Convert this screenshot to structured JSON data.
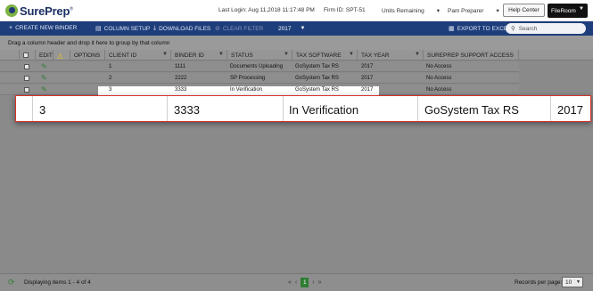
{
  "header": {
    "logo_text": "SurePrep",
    "logo_reg": "®",
    "last_login": "Last Login: Aug 11,2018 11:17:48 PM",
    "firm_id": "Firm ID:  SPT-51",
    "units_remaining": "Units Remaining",
    "user": "Pam Preparer",
    "help_label": "Help Center",
    "fileroom_label": "FileRoom"
  },
  "toolbar": {
    "create_label": "CREATE NEW BINDER",
    "column_setup_label": "COLUMN SETUP",
    "download_label": "DOWNLOAD FILES",
    "clear_filter_label": "CLEAR FILTER",
    "year": "2017",
    "export_label": "EXPORT TO EXCEL",
    "search_placeholder": "Search"
  },
  "grid": {
    "group_hint": "Drag a column header and drop it here to group by that column",
    "columns": {
      "edit": "EDIT",
      "options": "OPTIONS",
      "client_id": "CLIENT ID",
      "binder_id": "BINDER ID",
      "status": "STATUS",
      "tax_software": "TAX SOFTWARE",
      "tax_year": "TAX YEAR",
      "support_access": "SUREPREP SUPPORT ACCESS"
    },
    "rows": [
      {
        "client_id": "1",
        "binder_id": "1111",
        "status": "Documents Uploading",
        "tax_software": "GoSystem Tax RS",
        "tax_year": "2017",
        "support_access": "No Access"
      },
      {
        "client_id": "2",
        "binder_id": "2222",
        "status": "SP Processing",
        "tax_software": "GoSystem Tax RS",
        "tax_year": "2017",
        "support_access": "No Access"
      },
      {
        "client_id": "3",
        "binder_id": "3333",
        "status": "In Verification",
        "tax_software": "GoSystem Tax RS",
        "tax_year": "2017",
        "support_access": "No Access"
      }
    ]
  },
  "footer": {
    "displaying": "Displaying items 1 - 4 of 4",
    "current_page": "1",
    "records_per_page_label": "Records per page:",
    "records_per_page": "10"
  },
  "colors": {
    "toolbar_bg": "#1e3e7b",
    "pencil": "#2e7d32",
    "callout_border": "#d9342b"
  }
}
